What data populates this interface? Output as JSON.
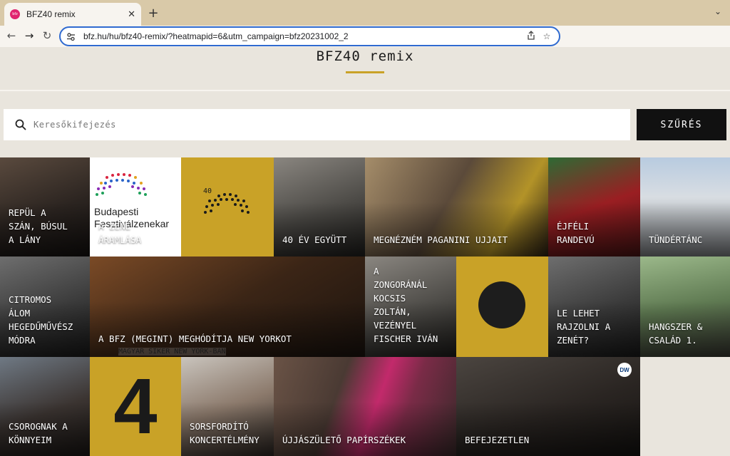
{
  "browser": {
    "tab_title": "BFZ40 remix",
    "favicon_text": "bfz",
    "url": "bfz.hu/hu/bfz40-remix/?heatmapid=6&utm_campaign=bfz20231002_2",
    "icons": {
      "back": "back-arrow-icon",
      "forward": "forward-arrow-icon",
      "reload": "reload-icon",
      "site_info": "site-info-icon",
      "share": "share-icon",
      "bookmark": "star-icon"
    }
  },
  "page": {
    "title": "BFZ40 remix",
    "accent_color": "#c9a227",
    "search": {
      "placeholder": "Keresőkifejezés",
      "button_label": "SZŰRÉS"
    },
    "tiles": {
      "t1": "REPÜL A\nSZÁN, BÚSUL\nA LÁNY",
      "t2": "A ZENE\nÁRAMLÁSA",
      "t2_logo": "Budapesti\nFesztiválzenekar",
      "t3_logo": "40",
      "t4": "40 ÉV EGYÜTT",
      "t5": "MEGNÉZNÉM PAGANINI UJJAIT",
      "t6": "ÉJFÉLI\nRANDEVÚ",
      "t7": "TÜNDÉRTÁNC",
      "t8": "CITROMOS\nÁLOM\nHEGEDŰMŰVÉSZ\nMÓDRA",
      "t9": "A BFZ (MEGINT) MEGHÓDÍTJA NEW YORKOT",
      "t9_caption": "MAGYAR SIKER NEW YORK-BAN",
      "t10": "A\nZONGORÁNÁL\nKOCSIS\nZOLTÁN,\nVEZÉNYEL\nFISCHER IVÁN",
      "t12": "LE LEHET\nRAJZOLNI A\nZENÉT?",
      "t13": "HANGSZER &\nCSALÁD 1.",
      "t14": "CSOROGNAK A\nKÖNNYEIM",
      "t15_digit": "4",
      "t16": "SORSFORDÍTÓ\nKONCERTÉLMÉNY",
      "t17": "ÚJJÁSZÜLETŐ PAPÍRSZÉKEK",
      "t18_badge": "DW",
      "t18": "BEFEJEZETLEN"
    }
  }
}
